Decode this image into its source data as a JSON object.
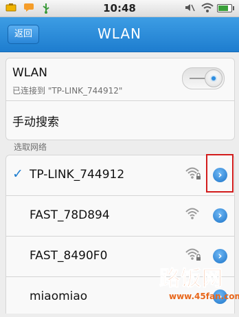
{
  "statusbar": {
    "time": "10:48",
    "left_icons": [
      "notification-icon",
      "chat-icon",
      "usb-icon"
    ],
    "right_icons": [
      "mute-icon",
      "wifi-icon",
      "battery-icon"
    ],
    "battery_level": 0.75
  },
  "titlebar": {
    "back_label": "返回",
    "title": "WLAN",
    "color": "#1e7dcf"
  },
  "wlan": {
    "label": "WLAN",
    "status": "已连接到 \"TP-LINK_744912\"",
    "enabled": true
  },
  "manual_search_label": "手动搜索",
  "section_label": "选取网络",
  "networks": [
    {
      "ssid": "TP-LINK_744912",
      "connected": true,
      "secured": true,
      "check": "✓",
      "arrow": "›"
    },
    {
      "ssid": "FAST_78D894",
      "connected": false,
      "secured": false,
      "check": "",
      "arrow": "›"
    },
    {
      "ssid": "FAST_8490F0",
      "connected": false,
      "secured": true,
      "check": "",
      "arrow": "›"
    },
    {
      "ssid": "miaomiao",
      "connected": false,
      "secured": false,
      "check": "",
      "arrow": "›"
    }
  ],
  "watermark": {
    "name": "路饭网",
    "url": "www.45fan.com"
  },
  "highlight_color": "#d21b1b"
}
